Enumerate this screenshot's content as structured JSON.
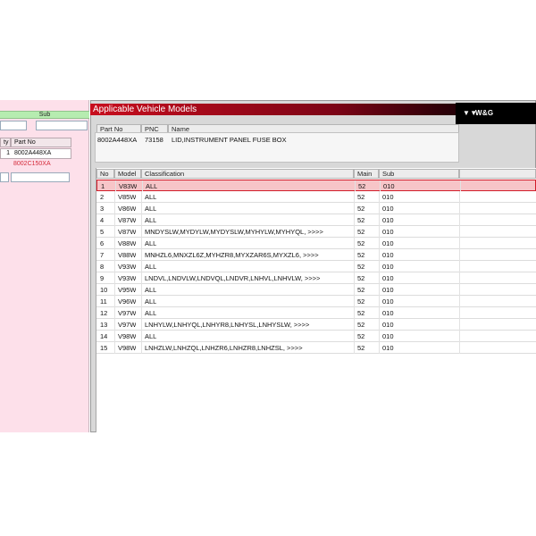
{
  "left_panel": {
    "sub_label": "Sub",
    "col_qty": "ty",
    "col_part_no": "Part No",
    "rows": [
      {
        "qty": "1",
        "part_no": "8002A448XA"
      },
      {
        "qty": "",
        "part_no": "8002C150XA"
      }
    ]
  },
  "window": {
    "title": "Applicable Vehicle Models",
    "logo_text": "W&G",
    "info": {
      "headers": {
        "part_no": "Part No",
        "pnc": "PNC",
        "name": "Name"
      },
      "part_no": "8002A448XA",
      "pnc": "73158",
      "name": "LID,INSTRUMENT PANEL FUSE BOX"
    },
    "grid": {
      "headers": {
        "no": "No",
        "model": "Model",
        "classification": "Classification",
        "main": "Main",
        "sub": "Sub"
      },
      "rows": [
        {
          "no": "1",
          "model": "V83W",
          "classification": "ALL",
          "main": "52",
          "sub": "010"
        },
        {
          "no": "2",
          "model": "V85W",
          "classification": "ALL",
          "main": "52",
          "sub": "010"
        },
        {
          "no": "3",
          "model": "V86W",
          "classification": "ALL",
          "main": "52",
          "sub": "010"
        },
        {
          "no": "4",
          "model": "V87W",
          "classification": "ALL",
          "main": "52",
          "sub": "010"
        },
        {
          "no": "5",
          "model": "V87W",
          "classification": "MNDYSLW,MYDYLW,MYDYSLW,MYHYLW,MYHYQL,  >>>>",
          "main": "52",
          "sub": "010"
        },
        {
          "no": "6",
          "model": "V88W",
          "classification": "ALL",
          "main": "52",
          "sub": "010"
        },
        {
          "no": "7",
          "model": "V88W",
          "classification": "MNHZL6,MNXZL6Z,MYHZR8,MYXZAR6S,MYXZL6,  >>>>",
          "main": "52",
          "sub": "010"
        },
        {
          "no": "8",
          "model": "V93W",
          "classification": "ALL",
          "main": "52",
          "sub": "010"
        },
        {
          "no": "9",
          "model": "V93W",
          "classification": "LNDVL,LNDVLW,LNDVQL,LNDVR,LNHVL,LNHVLW,  >>>>",
          "main": "52",
          "sub": "010"
        },
        {
          "no": "10",
          "model": "V95W",
          "classification": "ALL",
          "main": "52",
          "sub": "010"
        },
        {
          "no": "11",
          "model": "V96W",
          "classification": "ALL",
          "main": "52",
          "sub": "010"
        },
        {
          "no": "12",
          "model": "V97W",
          "classification": "ALL",
          "main": "52",
          "sub": "010"
        },
        {
          "no": "13",
          "model": "V97W",
          "classification": "LNHYLW,LNHYQL,LNHYR8,LNHYSL,LNHYSLW,  >>>>",
          "main": "52",
          "sub": "010"
        },
        {
          "no": "14",
          "model": "V98W",
          "classification": "ALL",
          "main": "52",
          "sub": "010"
        },
        {
          "no": "15",
          "model": "V98W",
          "classification": "LNHZLW,LNHZQL,LNHZR6,LNHZR8,LNHZSL,  >>>>",
          "main": "52",
          "sub": "010"
        }
      ]
    }
  },
  "colors": {
    "title_gradient_start": "#c80e1e",
    "selected_row": "#f7c5c8",
    "left_panel_bg": "#fde0ea",
    "sub_header_bg": "#b6ecb0"
  }
}
